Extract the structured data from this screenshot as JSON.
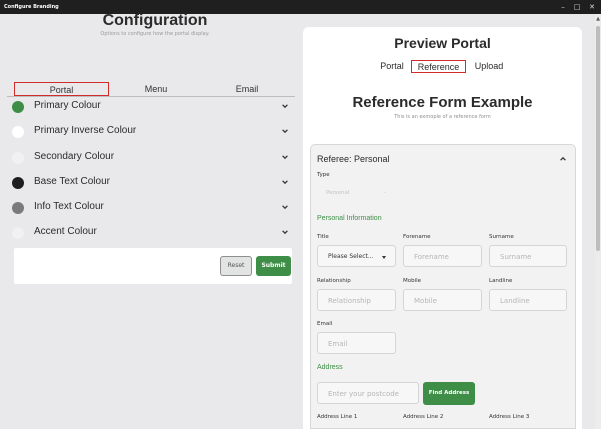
{
  "window": {
    "title": "Configure Branding",
    "controls": {
      "minimize": "–",
      "maximize": "□",
      "close": "✕"
    }
  },
  "configuration": {
    "title": "Configuration",
    "subtitle": "Options to configure how the portal display.",
    "tabs": [
      {
        "label": "Portal",
        "active": true
      },
      {
        "label": "Menu",
        "active": false
      },
      {
        "label": "Email",
        "active": false
      }
    ],
    "colour_rows": [
      {
        "label": "Primary Colour",
        "swatch": "#3e8e47"
      },
      {
        "label": "Primary Inverse Colour",
        "swatch": "#ffffff"
      },
      {
        "label": "Secondary Colour",
        "swatch": "#f1f1f1"
      },
      {
        "label": "Base Text Colour",
        "swatch": "#1e1e1e"
      },
      {
        "label": "Info Text Colour",
        "swatch": "#7a7a7a"
      },
      {
        "label": "Accent Colour",
        "swatch": "#f1f1f1"
      }
    ],
    "reset_label": "Reset",
    "submit_label": "Submit"
  },
  "preview": {
    "title": "Preview Portal",
    "tabs": [
      {
        "label": "Portal",
        "active": false
      },
      {
        "label": "Reference",
        "active": true
      },
      {
        "label": "Upload",
        "active": false
      }
    ],
    "form_title": "Reference Form Example",
    "form_subtitle": "This is an exmople of a reference form",
    "card_title": "Referee: Personal",
    "type_label": "Type",
    "type_value": "Personal",
    "type_dash": "-",
    "personal_section": "Personal Information",
    "labels": {
      "title": "Title",
      "forename": "Forename",
      "surname": "Surname",
      "relationship": "Relationship",
      "mobile": "Mobile",
      "landline": "Landline",
      "email": "Email",
      "address_line_1": "Address Line 1",
      "address_line_2": "Address Line 2",
      "address_line_3": "Address Line 3"
    },
    "placeholders": {
      "title": "Please Select...",
      "forename": "Forename",
      "surname": "Surname",
      "relationship": "Relationship",
      "mobile": "Mobile",
      "landline": "Landline",
      "email": "Email",
      "postcode": "Enter your postcode"
    },
    "address_section": "Address",
    "find_address_label": "Find Address"
  },
  "colors": {
    "accent_green": "#3e8e47",
    "highlight_red": "#d12b2b",
    "panel_bg": "#e9e9eb"
  }
}
